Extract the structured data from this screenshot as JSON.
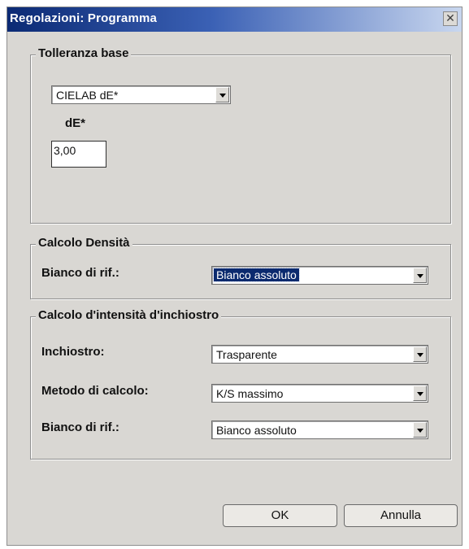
{
  "window": {
    "title": "Regolazioni: Programma",
    "close_glyph": "✕"
  },
  "base_tolerance": {
    "legend": "Tolleranza base",
    "formula_select": "CIELAB dE*",
    "de_label": "dE*",
    "de_value": "3,00"
  },
  "density": {
    "legend": "Calcolo Densità",
    "white_ref_label": "Bianco di rif.:",
    "white_ref_value": "Bianco assoluto"
  },
  "ink_strength": {
    "legend": "Calcolo d'intensità d'inchiostro",
    "ink_label": "Inchiostro:",
    "ink_value": "Trasparente",
    "method_label": "Metodo di calcolo:",
    "method_value": "K/S massimo",
    "white_ref_label": "Bianco di rif.:",
    "white_ref_value": "Bianco assoluto"
  },
  "buttons": {
    "ok": "OK",
    "cancel": "Annulla"
  },
  "icons": {
    "close": "close-icon",
    "dropdown": "chevron-down-icon"
  },
  "colors": {
    "title_bar": "#0b2a74",
    "dialog_bg": "#d9d7d3",
    "selection": "#0b2a6e"
  }
}
